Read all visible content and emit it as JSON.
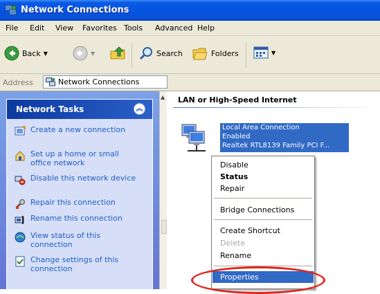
{
  "window": {
    "title": "Network Connections",
    "icon": "network-connections-icon"
  },
  "menubar": [
    "File",
    "Edit",
    "View",
    "Favorites",
    "Tools",
    "Advanced",
    "Help"
  ],
  "toolbar": {
    "back_label": "Back",
    "search_label": "Search",
    "folders_label": "Folders"
  },
  "address": {
    "label": "Address",
    "value": "Network Connections"
  },
  "network_tasks": {
    "title": "Network Tasks",
    "items": [
      {
        "label": "Create a new connection",
        "icon": "new-connection-icon"
      },
      {
        "label": "Set up a home or small office network",
        "icon": "home-network-icon"
      },
      {
        "label": "Disable this network device",
        "icon": "disable-device-icon"
      },
      {
        "label": "Repair this connection",
        "icon": "repair-icon"
      },
      {
        "label": "Rename this connection",
        "icon": "rename-icon"
      },
      {
        "label": "View status of this connection",
        "icon": "status-icon"
      },
      {
        "label": "Change settings of this connection",
        "icon": "settings-icon"
      }
    ]
  },
  "content": {
    "group_header": "LAN or High-Speed Internet",
    "connection": {
      "name": "Local Area Connection",
      "status": "Enabled",
      "device": "Realtek RTL8139 Family PCI F..."
    }
  },
  "context_menu": {
    "items": [
      {
        "label": "Disable"
      },
      {
        "label": "Status",
        "bold": true
      },
      {
        "label": "Repair"
      },
      {
        "label": "Bridge Connections"
      },
      {
        "label": "Create Shortcut"
      },
      {
        "label": "Delete",
        "disabled": true
      },
      {
        "label": "Rename"
      },
      {
        "label": "Properties",
        "selected": true
      }
    ]
  },
  "colors": {
    "titlebar": "#0553e1",
    "selection": "#316ac5",
    "task_link": "#215dc6",
    "annotation": "#e0241c"
  }
}
